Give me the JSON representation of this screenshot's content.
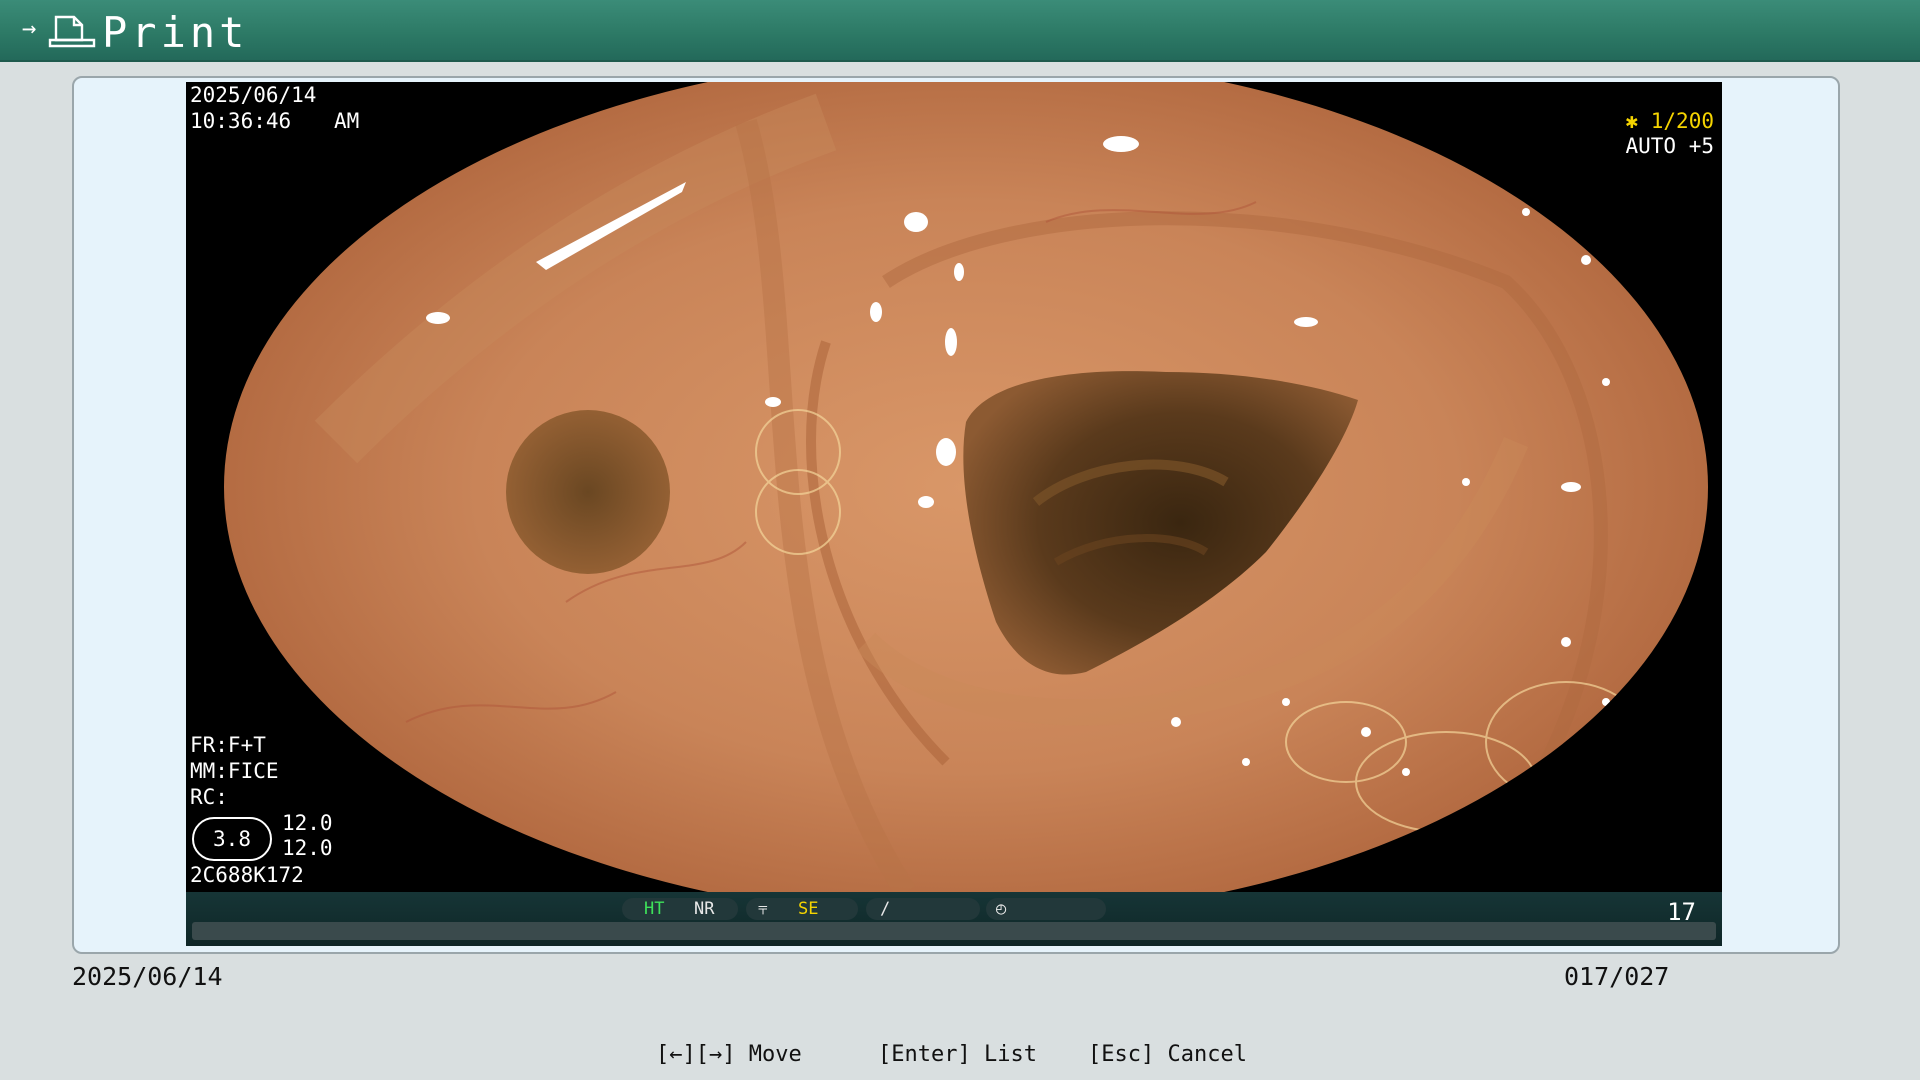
{
  "header": {
    "title": "Print",
    "back_arrow_icon": "arrow-right-icon",
    "print_icon": "document-icon"
  },
  "image": {
    "date": "2025/06/14",
    "time": "10:36:46",
    "ampm": "AM",
    "shutter": "✱ 1/200",
    "iris": "AUTO +5",
    "fr": "FR:F+T",
    "mm": "MM:FICE",
    "rc": "RC:",
    "zoom": "3.8",
    "val1": "12.0",
    "val2": "12.0",
    "serial": "2C688K172",
    "status": {
      "ht": "HT",
      "nr": "NR",
      "se": "SE"
    },
    "frame_number": "17"
  },
  "footer": {
    "date": "2025/06/14",
    "count": "017/027"
  },
  "help": {
    "move": "[←][→] Move",
    "list": "[Enter] List",
    "cancel": "[Esc] Cancel"
  },
  "colors": {
    "header": "#2d7a66",
    "background": "#d9dfe0",
    "panel": "#e6f3fb",
    "overlay_accent": "#f5d400",
    "status_green": "#3ee25a"
  }
}
